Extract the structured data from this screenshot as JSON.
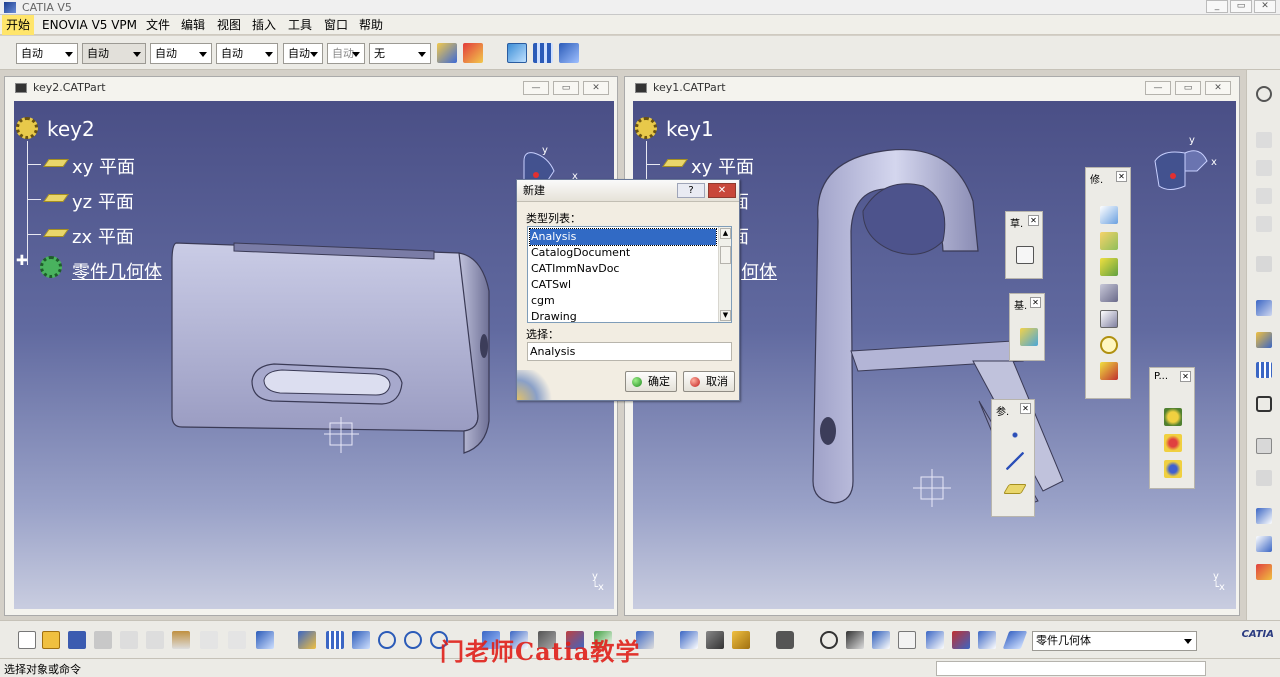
{
  "app": {
    "title": "CATIA V5"
  },
  "menu": [
    "开始",
    "ENOVIA V5 VPM",
    "文件",
    "编辑",
    "视图",
    "插入",
    "工具",
    "窗口",
    "帮助"
  ],
  "toolbar_combos": [
    "自动",
    "自动",
    "自动",
    "自动",
    "自动",
    "自动",
    "无"
  ],
  "left_window": {
    "title": "key2.CATPart",
    "tree": {
      "root": "key2",
      "items": [
        "xy 平面",
        "yz 平面",
        "zx 平面",
        "零件几何体"
      ]
    }
  },
  "right_window": {
    "title": "key1.CATPart",
    "tree": {
      "root": "key1",
      "items": [
        "xy 平面",
        "面",
        "面",
        "何体"
      ]
    }
  },
  "dialog": {
    "title": "新建",
    "help_label": "?",
    "list_label": "类型列表：",
    "types": [
      "Analysis",
      "CatalogDocument",
      "CATImmNavDoc",
      "CATSwl",
      "cgm",
      "Drawing"
    ],
    "selected": "Analysis",
    "select_label": "选择：",
    "select_value": "Analysis",
    "ok_label": "确定",
    "cancel_label": "取消"
  },
  "palettes": {
    "sketch": "草.",
    "base": "基.",
    "ref": "参.",
    "modify": "修.",
    "part": "P..."
  },
  "bottom": {
    "part_combo": "零件几何体"
  },
  "status": {
    "text": "选择对象或命令"
  },
  "watermark": "门老师Catia教学",
  "logo": "CATIA",
  "colors": {
    "active_menu": "#ffe56b",
    "selection": "#316ac5",
    "viewport_top": "#4a4f86",
    "viewport_bottom": "#c9cde0"
  }
}
